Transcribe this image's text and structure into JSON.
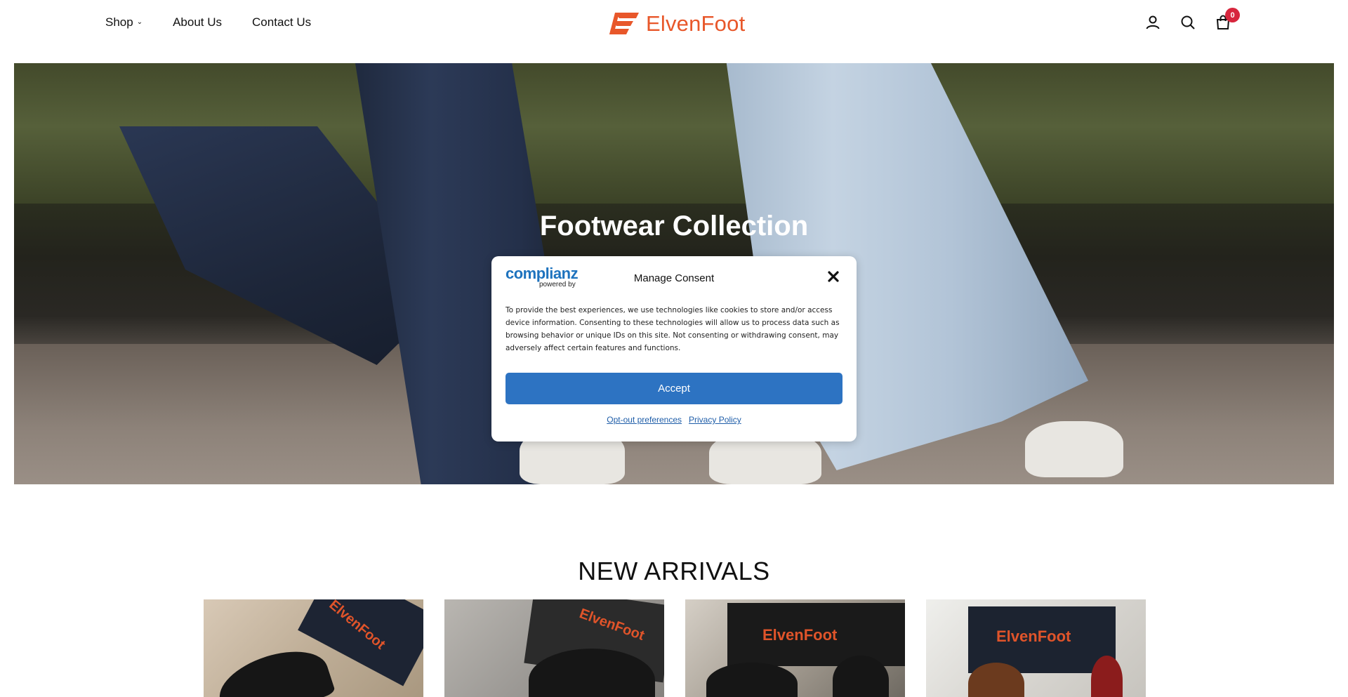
{
  "header": {
    "nav": [
      {
        "label": "Shop",
        "has_dropdown": true
      },
      {
        "label": "About Us"
      },
      {
        "label": "Contact Us"
      }
    ],
    "logo_text": "ElvenFoot",
    "cart_count": "0",
    "icons": [
      "user-icon",
      "search-icon",
      "cart-icon"
    ],
    "brand_color": "#e8572a"
  },
  "hero": {
    "title": "Footwear Collection"
  },
  "consent": {
    "provider": "complianz",
    "provider_sub": "powered by",
    "title": "Manage Consent",
    "body": "To provide the best experiences, we use technologies like cookies to store and/or access device information. Consenting to these technologies will allow us to process data such as browsing behavior or unique IDs on this site. Not consenting or withdrawing consent, may adversely affect certain features and functions.",
    "accept_label": "Accept",
    "links": [
      "Opt-out preferences",
      "Privacy Policy"
    ],
    "accent_color": "#2d73c2"
  },
  "new_arrivals": {
    "heading": "NEW ARRIVALS",
    "products": [
      {
        "box_text": "ElvenFoot"
      },
      {
        "box_text": "ElvenFoot"
      },
      {
        "box_text": "ElvenFoot"
      },
      {
        "box_text": "ElvenFoot"
      }
    ]
  }
}
